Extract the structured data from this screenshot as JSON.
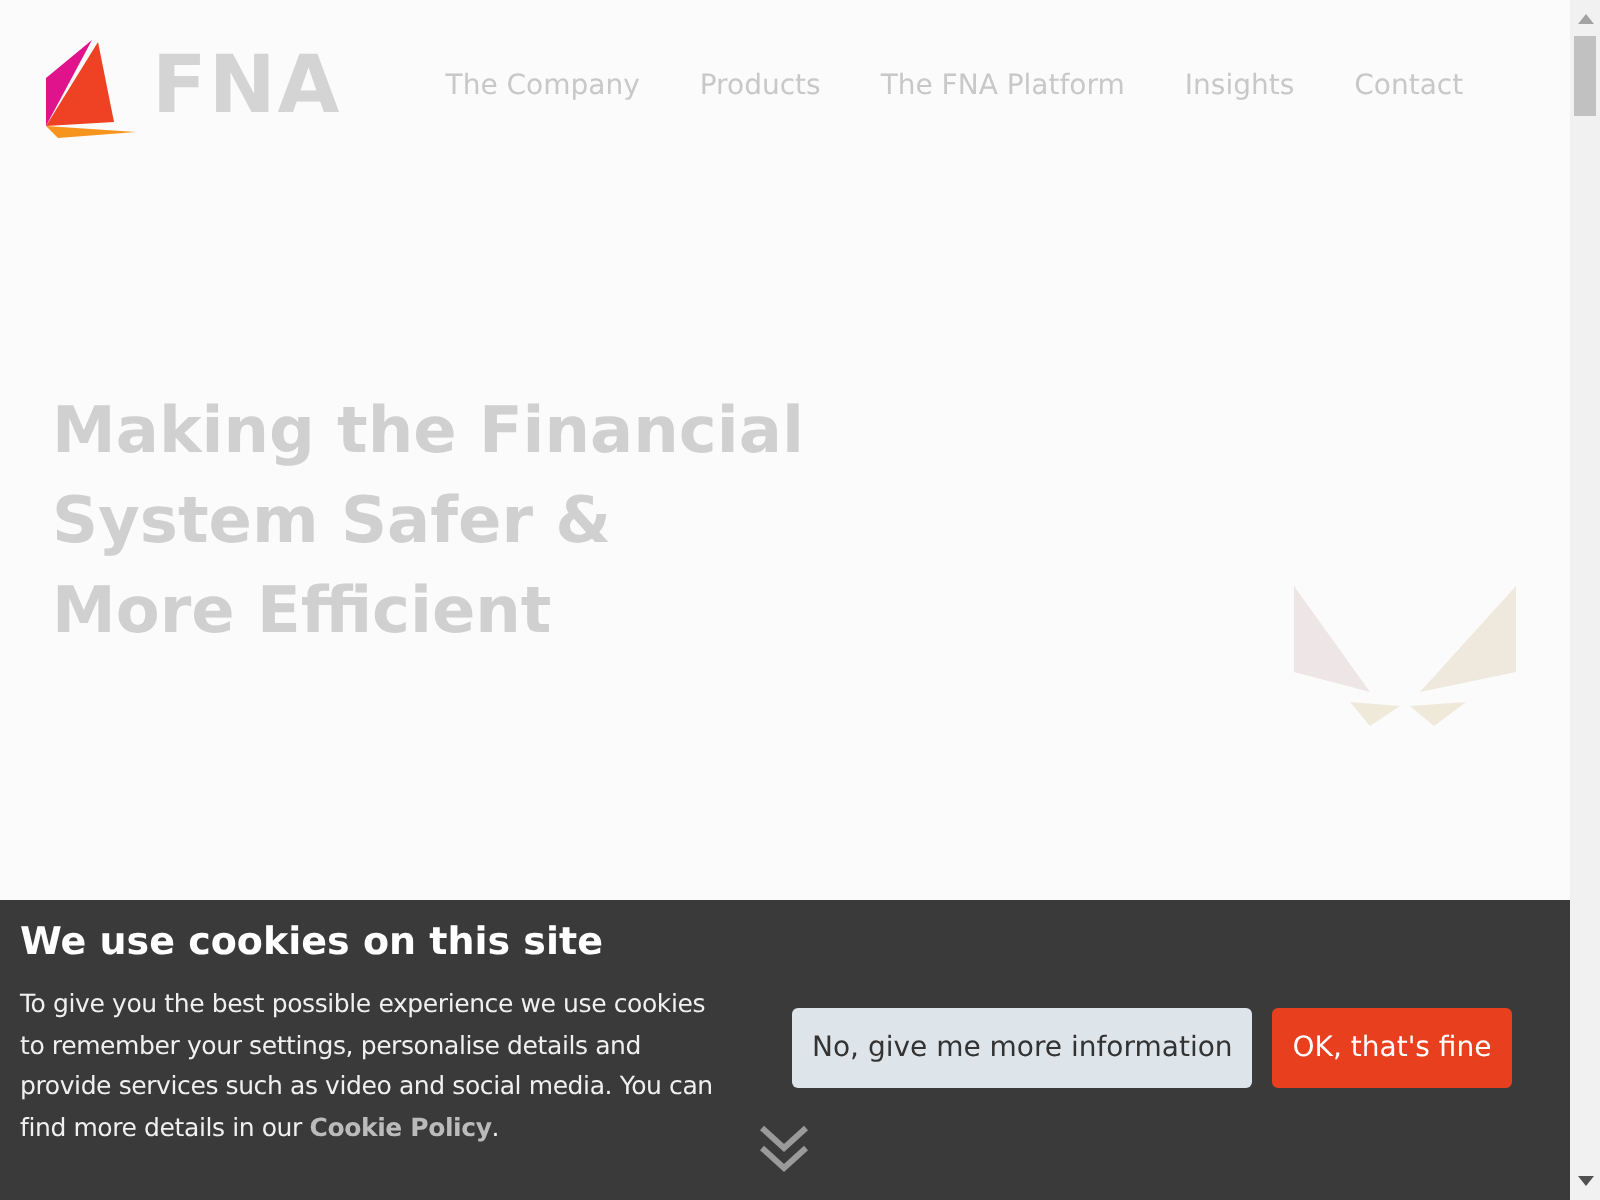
{
  "header": {
    "logo_text": "FNA",
    "nav": [
      {
        "label": "The Company"
      },
      {
        "label": "Products"
      },
      {
        "label": "The FNA Platform"
      },
      {
        "label": "Insights"
      },
      {
        "label": "Contact"
      }
    ]
  },
  "hero": {
    "title_lines": [
      "Making the Financial",
      "System Safer &",
      "More Efficient"
    ]
  },
  "cookie_banner": {
    "title": "We use cookies on this site",
    "text": "To give you the best possible experience we use cookies to remember your settings, personalise details and provide services such as video and social media. You can find more details in our ",
    "link": "Cookie Policy",
    "text_end": ".",
    "buttons": [
      {
        "label": "No, give me more information",
        "kind": "secondary"
      },
      {
        "label": "OK, that's fine",
        "kind": "primary"
      }
    ]
  }
}
